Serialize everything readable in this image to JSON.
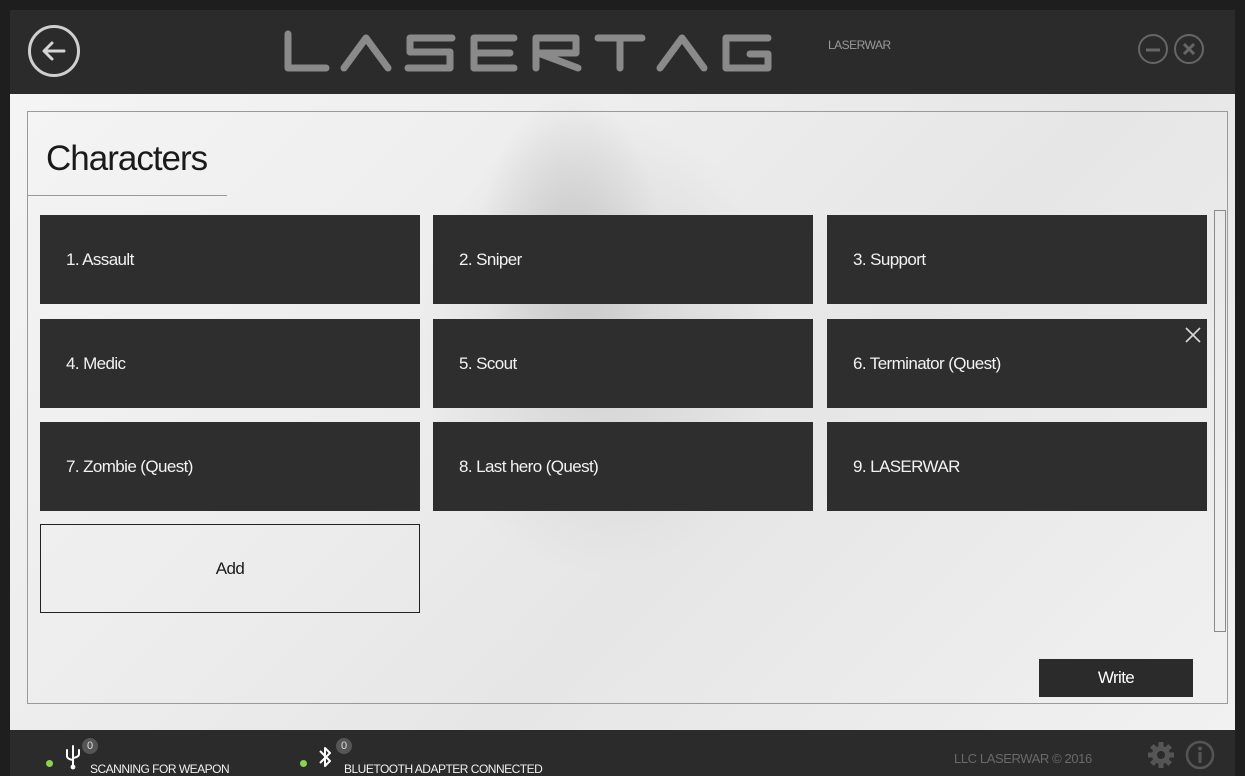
{
  "header": {
    "logo_text": "LASERTAG",
    "logo_sub": "LASERWAR",
    "back_icon": "back-arrow-icon",
    "minimize_icon": "minimize-icon",
    "close_icon": "close-icon"
  },
  "page": {
    "title": "Characters"
  },
  "characters": [
    {
      "label": "1. Assault"
    },
    {
      "label": "2. Sniper"
    },
    {
      "label": "3. Support"
    },
    {
      "label": "4. Medic"
    },
    {
      "label": "5. Scout"
    },
    {
      "label": "6. Terminator (Quest)"
    },
    {
      "label": "7. Zombie (Quest)"
    },
    {
      "label": "8. Last hero (Quest)"
    },
    {
      "label": "9. LASERWAR"
    }
  ],
  "actions": {
    "add_label": "Add",
    "write_label": "Write"
  },
  "status": {
    "usb_count": "0",
    "usb_text": "SCANNING FOR WEAPON",
    "bt_count": "0",
    "bt_text": "BLUETOOTH ADAPTER CONNECTED",
    "copyright": "LLC LASERWAR © 2016",
    "indicator_color": "#8bd44a"
  }
}
